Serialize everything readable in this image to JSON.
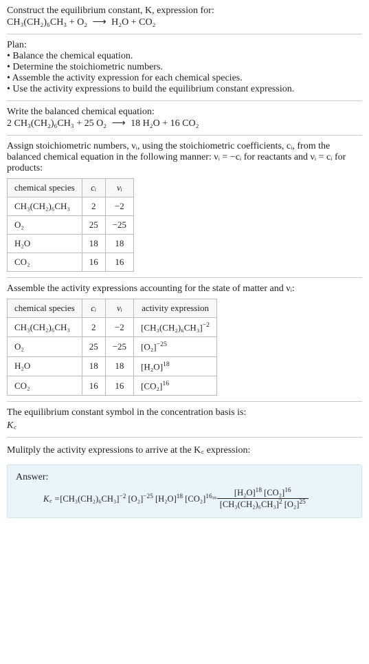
{
  "intro": {
    "line1": "Construct the equilibrium constant, K, expression for:",
    "reaction_lhs1": "CH₃(CH₂)₆CH₃ + O₂",
    "reaction_arrow": "⟶",
    "reaction_rhs1": "H₂O + CO₂"
  },
  "plan": {
    "heading": "Plan:",
    "b1": "• Balance the chemical equation.",
    "b2": "• Determine the stoichiometric numbers.",
    "b3": "• Assemble the activity expression for each chemical species.",
    "b4": "• Use the activity expressions to build the equilibrium constant expression."
  },
  "balanced": {
    "heading": "Write the balanced chemical equation:",
    "lhs": "2 CH₃(CH₂)₆CH₃ + 25 O₂",
    "arrow": "⟶",
    "rhs": "18 H₂O + 16 CO₂"
  },
  "assign": {
    "text1": "Assign stoichiometric numbers, νᵢ, using the stoichiometric coefficients, cᵢ, from the balanced chemical equation in the following manner: νᵢ = −cᵢ for reactants and νᵢ = cᵢ for products:",
    "h_species": "chemical species",
    "h_ci": "cᵢ",
    "h_vi": "νᵢ",
    "rows": [
      {
        "sp": "CH₃(CH₂)₆CH₃",
        "c": "2",
        "v": "−2"
      },
      {
        "sp": "O₂",
        "c": "25",
        "v": "−25"
      },
      {
        "sp": "H₂O",
        "c": "18",
        "v": "18"
      },
      {
        "sp": "CO₂",
        "c": "16",
        "v": "16"
      }
    ]
  },
  "activity": {
    "heading": "Assemble the activity expressions accounting for the state of matter and νᵢ:",
    "h_species": "chemical species",
    "h_ci": "cᵢ",
    "h_vi": "νᵢ",
    "h_act": "activity expression",
    "rows": [
      {
        "sp": "CH₃(CH₂)₆CH₃",
        "c": "2",
        "v": "−2",
        "base": "[CH₃(CH₂)₆CH₃]",
        "exp": "−2"
      },
      {
        "sp": "O₂",
        "c": "25",
        "v": "−25",
        "base": "[O₂]",
        "exp": "−25"
      },
      {
        "sp": "H₂O",
        "c": "18",
        "v": "18",
        "base": "[H₂O]",
        "exp": "18"
      },
      {
        "sp": "CO₂",
        "c": "16",
        "v": "16",
        "base": "[CO₂]",
        "exp": "16"
      }
    ]
  },
  "symbol": {
    "line": "The equilibrium constant symbol in the concentration basis is:",
    "kc": "K꜀"
  },
  "multiply": {
    "line": "Mulitply the activity expressions to arrive at the K꜀ expression:"
  },
  "answer": {
    "label": "Answer:",
    "kc": "K꜀ = ",
    "t1b": "[CH₃(CH₂)₆CH₃]",
    "t1e": "−2",
    "t2b": "[O₂]",
    "t2e": "−25",
    "t3b": "[H₂O]",
    "t3e": "18",
    "t4b": "[CO₂]",
    "t4e": "16",
    "eq": " = ",
    "num1b": "[H₂O]",
    "num1e": "18",
    "num2b": "[CO₂]",
    "num2e": "16",
    "den1b": "[CH₃(CH₂)₆CH₃]",
    "den1e": "2",
    "den2b": "[O₂]",
    "den2e": "25"
  },
  "chart_data": {
    "type": "table",
    "title": "Stoichiometric numbers and activity expressions for 2 CH3(CH2)6CH3 + 25 O2 → 18 H2O + 16 CO2",
    "columns": [
      "chemical species",
      "c_i",
      "ν_i",
      "activity expression"
    ],
    "rows": [
      [
        "CH3(CH2)6CH3",
        2,
        -2,
        "[CH3(CH2)6CH3]^(-2)"
      ],
      [
        "O2",
        25,
        -25,
        "[O2]^(-25)"
      ],
      [
        "H2O",
        18,
        18,
        "[H2O]^(18)"
      ],
      [
        "CO2",
        16,
        16,
        "[CO2]^(16)"
      ]
    ],
    "equilibrium_constant": "Kc = [H2O]^18 [CO2]^16 / ([CH3(CH2)6CH3]^2 [O2]^25)"
  }
}
